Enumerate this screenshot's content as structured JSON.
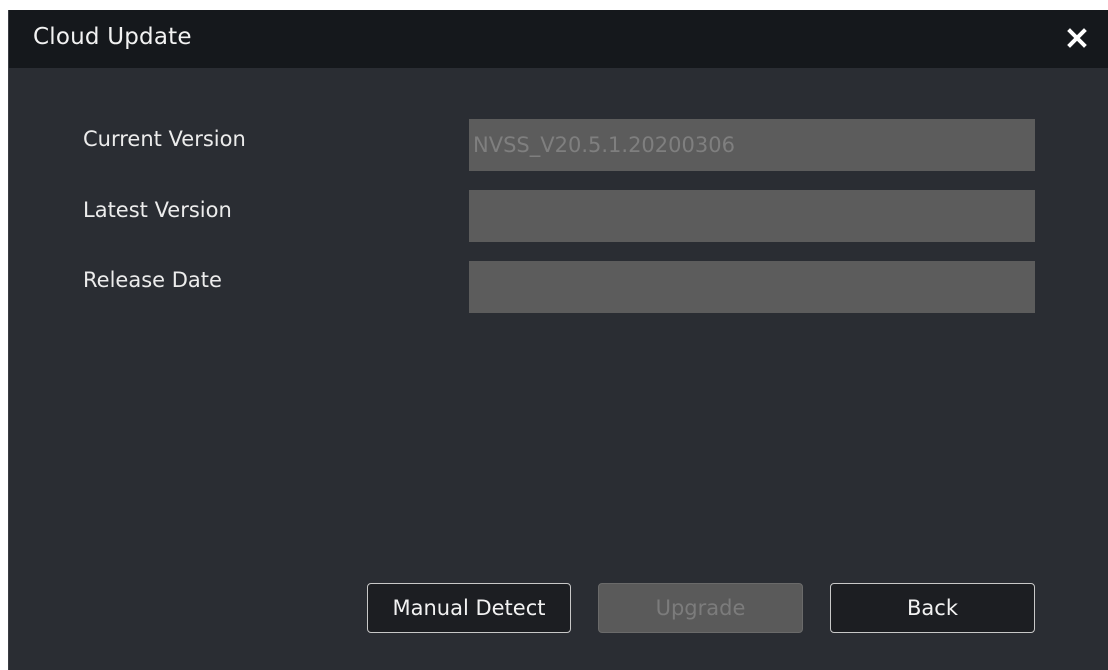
{
  "dialog": {
    "title": "Cloud Update",
    "close_icon": "close-icon"
  },
  "form": {
    "current_version": {
      "label": "Current Version",
      "value": "NVSS_V20.5.1.20200306"
    },
    "latest_version": {
      "label": "Latest Version",
      "value": ""
    },
    "release_date": {
      "label": "Release Date",
      "value": ""
    }
  },
  "buttons": {
    "manual_detect": "Manual Detect",
    "upgrade": "Upgrade",
    "back": "Back"
  },
  "colors": {
    "dialog_background": "#2a2d33",
    "titlebar_background": "#15181c",
    "field_background": "#5c5c5c",
    "disabled_button": "#5a5a5a"
  }
}
